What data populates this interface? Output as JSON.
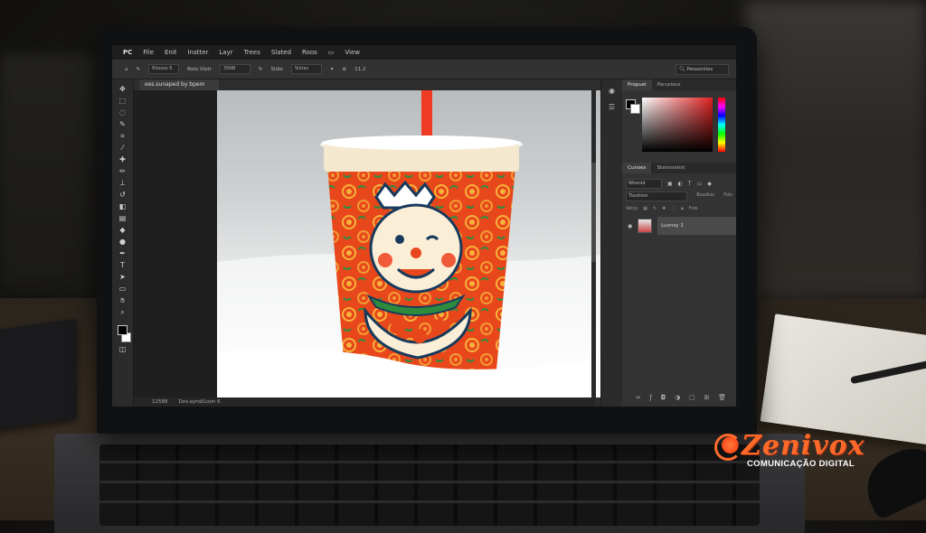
{
  "menu": {
    "app_logo": "PC",
    "items": [
      "File",
      "Enit",
      "Instter",
      "Layr",
      "Trees",
      "Slated",
      "Roos",
      "View"
    ]
  },
  "options_bar": {
    "brush_size": "Rilosos 6",
    "opt1_label": "Bolo Viotr",
    "opt1_value": "3SNB",
    "opt2_label": "Slide",
    "opt2_value": "Slotas",
    "opt3_value": "11.2",
    "search_placeholder": "Pessonilos"
  },
  "document": {
    "tab_title": "ees.sunaped by bpem",
    "zoom": "12588",
    "status_text": "Dov.aynd/Loon 6"
  },
  "right_panel": {
    "tabs": [
      "Propuel",
      "Parusiecs"
    ],
    "layer_tabs": [
      "Cunoes",
      "Statnsiehst"
    ],
    "kind_filter": "Woonld",
    "blend_mode": "Tiovtiom",
    "opacity_label": "Boadizo",
    "opacity_value": "Fols",
    "lock_label": "Velcy",
    "fill_value": "Fols",
    "layer_name": "Luvnsy 1"
  },
  "watermark": {
    "brand": "Zenivox",
    "tagline": "COMUNICAÇÃO DIGITAL"
  },
  "colors": {
    "cup_orange": "#e8471c",
    "accent_brand": "#ff6a2a"
  }
}
